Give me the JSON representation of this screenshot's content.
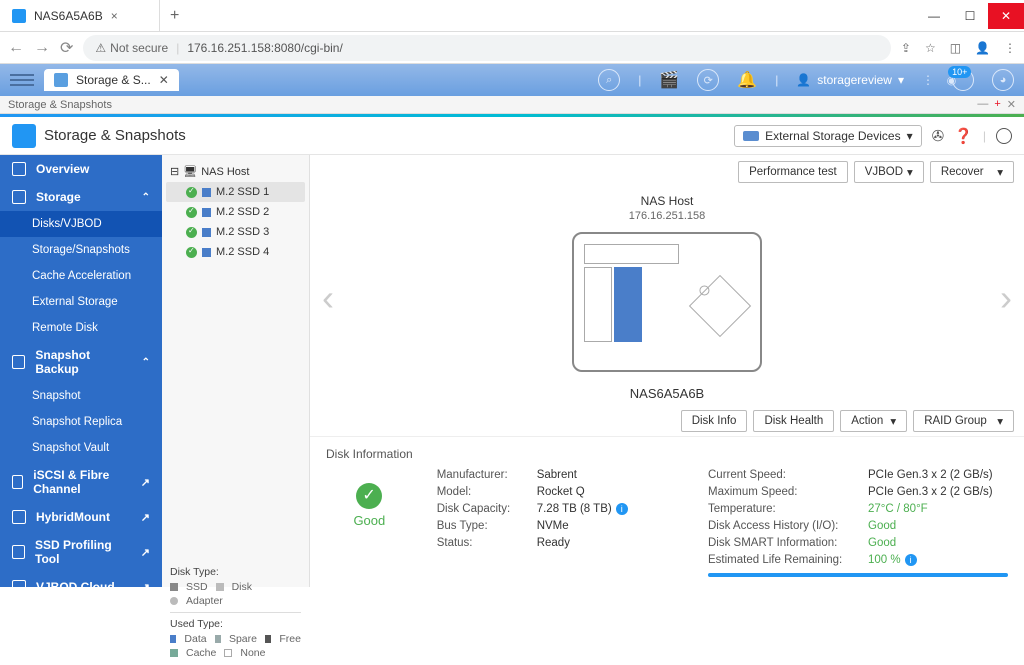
{
  "browser": {
    "tab_title": "NAS6A5A6B",
    "not_secure": "Not secure",
    "url": "176.16.251.158:8080/cgi-bin/"
  },
  "topbar": {
    "app_tab": "Storage & S...",
    "username": "storagereview",
    "notif": "10+"
  },
  "breadcrumb": "Storage & Snapshots",
  "module": {
    "title": "Storage & Snapshots",
    "external_btn": "External Storage Devices"
  },
  "sidebar": {
    "overview": "Overview",
    "storage": "Storage",
    "disks": "Disks/VJBOD",
    "storage_snap": "Storage/Snapshots",
    "cache": "Cache Acceleration",
    "ext_storage": "External Storage",
    "remote": "Remote Disk",
    "snap_backup": "Snapshot Backup",
    "snapshot": "Snapshot",
    "snap_replica": "Snapshot Replica",
    "snap_vault": "Snapshot Vault",
    "iscsi": "iSCSI & Fibre Channel",
    "hybrid": "HybridMount",
    "ssd_profiling": "SSD Profiling Tool",
    "vjbod": "VJBOD Cloud"
  },
  "tree": {
    "root": "NAS Host",
    "items": [
      "M.2 SSD 1",
      "M.2 SSD 2",
      "M.2 SSD 3",
      "M.2 SSD 4"
    ]
  },
  "legend": {
    "disk_type": "Disk Type:",
    "ssd": "SSD",
    "disk": "Disk",
    "adapter": "Adapter",
    "used_type": "Used Type:",
    "data": "Data",
    "spare": "Spare",
    "free": "Free",
    "cache": "Cache",
    "none": "None"
  },
  "actions": {
    "perf": "Performance test",
    "vjbod": "VJBOD",
    "recover": "Recover",
    "disk_info": "Disk Info",
    "disk_health": "Disk Health",
    "action": "Action",
    "raid": "RAID Group"
  },
  "device": {
    "host_label": "NAS Host",
    "host_ip": "176.16.251.158",
    "name": "NAS6A5A6B"
  },
  "disk_info": {
    "title": "Disk Information",
    "status": "Good",
    "manufacturer_lbl": "Manufacturer:",
    "manufacturer": "Sabrent",
    "model_lbl": "Model:",
    "model": "Rocket Q",
    "capacity_lbl": "Disk Capacity:",
    "capacity": "7.28 TB (8 TB)",
    "bus_lbl": "Bus Type:",
    "bus": "NVMe",
    "status_lbl": "Status:",
    "status_val": "Ready",
    "cur_speed_lbl": "Current Speed:",
    "cur_speed": "PCIe Gen.3 x 2 (2 GB/s)",
    "max_speed_lbl": "Maximum Speed:",
    "max_speed": "PCIe Gen.3 x 2 (2 GB/s)",
    "temp_lbl": "Temperature:",
    "temp": "27°C / 80°F",
    "io_lbl": "Disk Access History (I/O):",
    "io": "Good",
    "smart_lbl": "Disk SMART Information:",
    "smart": "Good",
    "life_lbl": "Estimated Life Remaining:",
    "life": "100 %"
  }
}
